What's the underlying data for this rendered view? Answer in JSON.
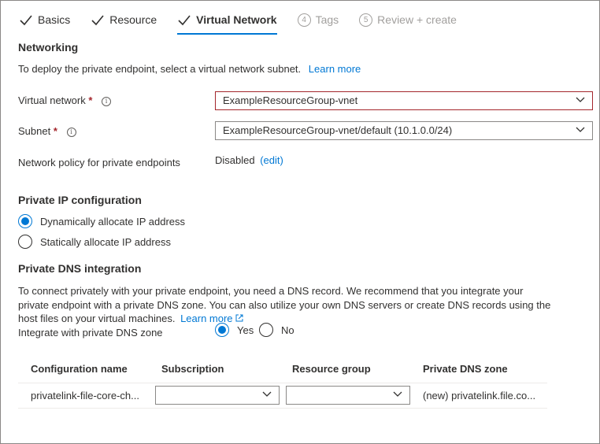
{
  "tabs": [
    {
      "label": "Basics",
      "state": "done"
    },
    {
      "label": "Resource",
      "state": "done"
    },
    {
      "label": "Virtual Network",
      "state": "active"
    },
    {
      "label": "Tags",
      "num": "4",
      "state": "disabled"
    },
    {
      "label": "Review + create",
      "num": "5",
      "state": "disabled"
    }
  ],
  "networking": {
    "heading": "Networking",
    "description": "To deploy the private endpoint, select a virtual network subnet.",
    "learn_more": "Learn more",
    "vnet_label": "Virtual network",
    "vnet_value": "ExampleResourceGroup-vnet",
    "subnet_label": "Subnet",
    "subnet_value": "ExampleResourceGroup-vnet/default (10.1.0.0/24)",
    "policy_label": "Network policy for private endpoints",
    "policy_value": "Disabled",
    "policy_edit": "(edit)",
    "required_mark": "*",
    "info_glyph": "i"
  },
  "ip_config": {
    "heading": "Private IP configuration",
    "options": [
      "Dynamically allocate IP address",
      "Statically allocate IP address"
    ],
    "selected": "Dynamically allocate IP address"
  },
  "dns": {
    "heading": "Private DNS integration",
    "description_line1": "To connect privately with your private endpoint, you need a DNS record. We recommend that you integrate your",
    "description_line2": "private endpoint with a private DNS zone. You can also utilize your own DNS servers or create DNS records using the",
    "description_line3": "host files on your virtual machines.",
    "learn_more": "Learn more",
    "integrate_label": "Integrate with private DNS zone",
    "yes": "Yes",
    "no": "No",
    "selected": "Yes"
  },
  "table": {
    "columns": [
      "Configuration name",
      "Subscription",
      "Resource group",
      "Private DNS zone"
    ],
    "rows": [
      {
        "config_name": "privatelink-file-core-ch...",
        "subscription": "",
        "resource_group": "",
        "dns_zone": "(new) privatelink.file.co..."
      }
    ]
  },
  "colors": {
    "accent": "#0078d4",
    "required": "#a4262c",
    "text": "#323130",
    "disabled": "#a19f9d"
  }
}
